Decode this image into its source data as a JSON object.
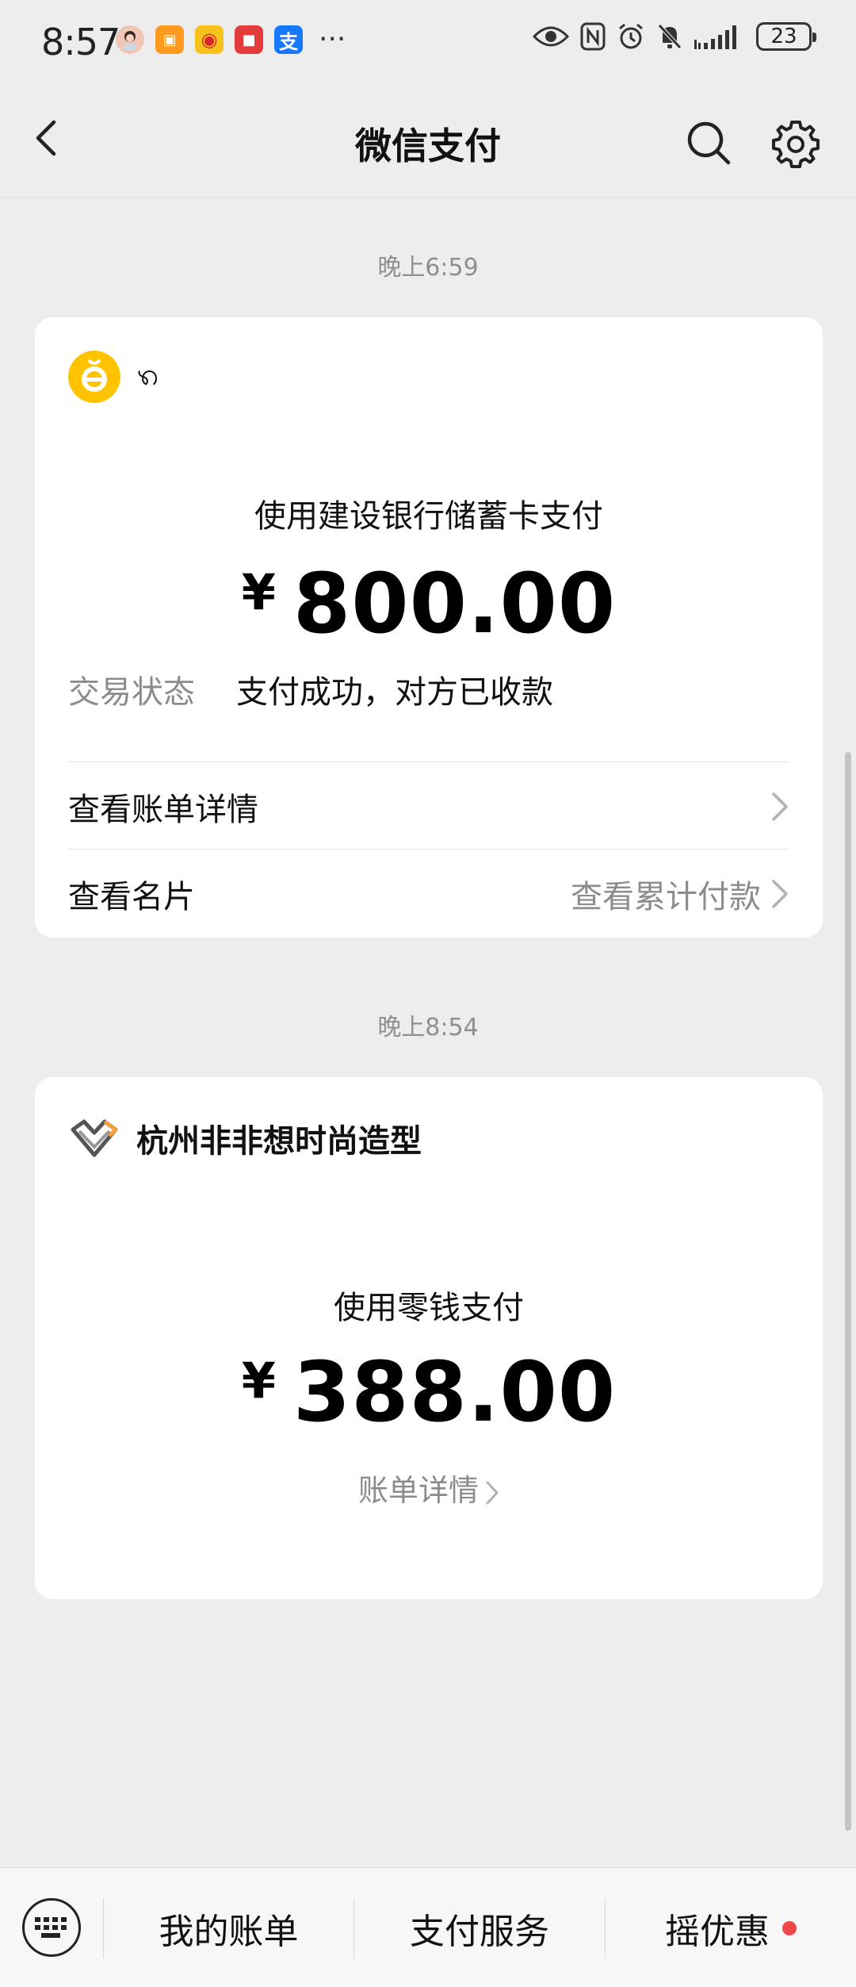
{
  "status_bar": {
    "time": "8:57",
    "apps": [
      {
        "name": "avatar-app-icon",
        "glyph": "",
        "color": "#f2c6b6"
      },
      {
        "name": "taobao-icon",
        "glyph": "▣",
        "color": "#ff9a1f"
      },
      {
        "name": "weibo-icon",
        "glyph": "◉",
        "color": "#f6c21b"
      },
      {
        "name": "red-book-icon",
        "glyph": "■",
        "color": "#e43b3b"
      },
      {
        "name": "alipay-icon",
        "glyph": "支",
        "color": "#1677ff"
      }
    ],
    "more": "···",
    "battery": "23"
  },
  "nav": {
    "title": "微信支付"
  },
  "transactions": [
    {
      "time": "晚上6:59",
      "merchant": "ꩫ",
      "method": "使用建设银行储蓄卡支付",
      "currency": "¥",
      "amount": "800.00",
      "status_label": "交易状态",
      "status_value": "支付成功，对方已收款",
      "link_bill": "查看账单详情",
      "link_card": "查看名片",
      "link_cumulative": "查看累计付款"
    },
    {
      "time": "晚上8:54",
      "merchant": "杭州非非想时尚造型",
      "method": "使用零钱支付",
      "currency": "¥",
      "amount": "388.00",
      "detail_link": "账单详情"
    }
  ],
  "bottom_bar": {
    "items": [
      "我的账单",
      "支付服务",
      "摇优惠"
    ]
  },
  "colors": {
    "background": "#ededed",
    "card": "#ffffff",
    "accent_red": "#f04848",
    "avatar_yellow": "#ffc300"
  }
}
